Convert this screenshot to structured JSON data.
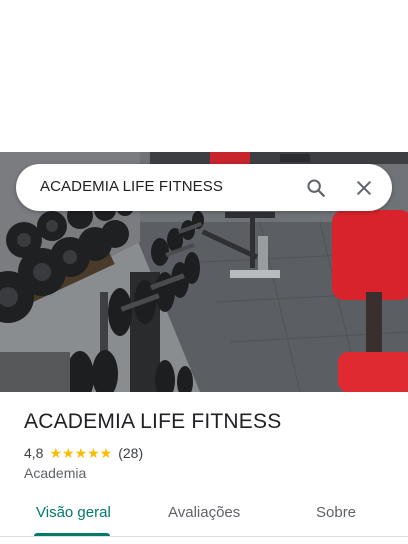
{
  "search": {
    "query": "ACADEMIA LIFE FITNESS",
    "search_icon": "search-icon",
    "close_icon": "close-icon"
  },
  "hero": {
    "image": "gym-dumbbell-rack-photo"
  },
  "place": {
    "name": "ACADEMIA LIFE FITNESS",
    "rating": "4,8",
    "stars": 5,
    "stars_text": "★★★★★",
    "reviews": "(28)",
    "category": "Academia"
  },
  "tabs": [
    {
      "label": "Visão geral",
      "active": true
    },
    {
      "label": "Avaliações",
      "active": false
    },
    {
      "label": "Sobre",
      "active": false
    }
  ],
  "colors": {
    "accent": "#00796b",
    "star": "#fbbc04",
    "text_primary": "#202124",
    "text_secondary": "#5f6368"
  }
}
